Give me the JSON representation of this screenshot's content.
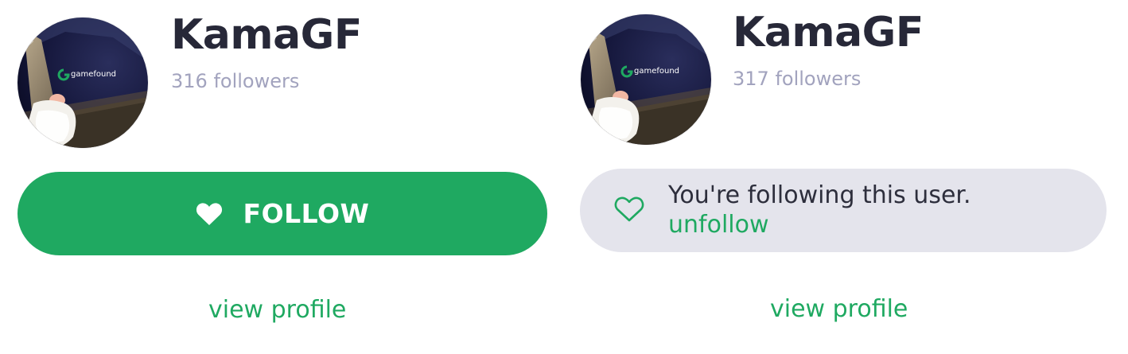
{
  "colors": {
    "accent": "#1fa961",
    "name_text": "#272838",
    "muted_text": "#a2a3be",
    "following_bg": "#e4e4ec"
  },
  "cards": [
    {
      "username": "KamaGF",
      "followers": "316 followers",
      "follow_button": {
        "label": "FOLLOW",
        "icon": "heart-icon"
      },
      "view_profile": "view profile",
      "avatar_logo": "gamefound"
    },
    {
      "username": "KamaGF",
      "followers": "317 followers",
      "following_status": {
        "text": "You're following this user.",
        "unfollow": "unfollow",
        "icon": "heart-outline-icon"
      },
      "view_profile": "view profile",
      "avatar_logo": "gamefound"
    }
  ]
}
